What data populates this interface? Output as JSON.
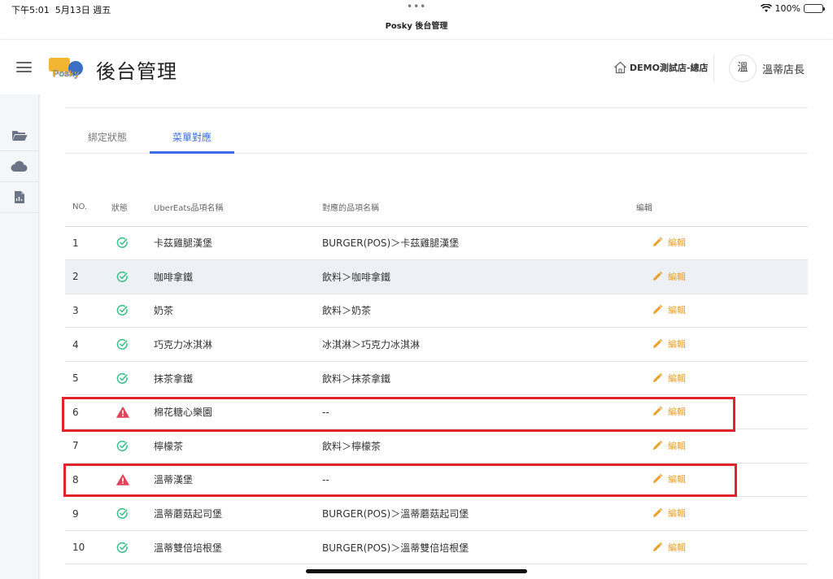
{
  "statusbar": {
    "time": "下午5:01",
    "date": "5月13日 週五",
    "dots": "•••",
    "battery": "100%"
  },
  "app_title": "Posky 後台管理",
  "header": {
    "logo_text": "Posky",
    "title": "後台管理",
    "store": "DEMO測試店-總店",
    "avatar": "溫",
    "user": "溫蒂店長"
  },
  "sidebar": {
    "items": [
      "folder-icon",
      "cloud-icon",
      "document-icon"
    ]
  },
  "tabs": [
    {
      "label": "綁定狀態",
      "active": false
    },
    {
      "label": "菜單對應",
      "active": true
    }
  ],
  "table": {
    "headers": {
      "no": "NO.",
      "status": "狀態",
      "ubereats": "UberEats品項名稱",
      "mapped": "對應的品項名稱",
      "edit": "編輯"
    },
    "rows": [
      {
        "no": "1",
        "status": "ok",
        "ubereats": "卡茲雞腿漢堡",
        "mapped": "BURGER(POS)＞卡茲雞腿漢堡",
        "edit": "編輯"
      },
      {
        "no": "2",
        "status": "ok",
        "ubereats": "咖啡拿鐵",
        "mapped": "飲料＞咖啡拿鐵",
        "edit": "編輯"
      },
      {
        "no": "3",
        "status": "ok",
        "ubereats": "奶茶",
        "mapped": "飲料＞奶茶",
        "edit": "編輯"
      },
      {
        "no": "4",
        "status": "ok",
        "ubereats": "巧克力冰淇淋",
        "mapped": "冰淇淋＞巧克力冰淇淋",
        "edit": "編輯"
      },
      {
        "no": "5",
        "status": "ok",
        "ubereats": "抹茶拿鐵",
        "mapped": "飲料＞抹茶拿鐵",
        "edit": "編輯"
      },
      {
        "no": "6",
        "status": "warning",
        "ubereats": "棉花糖心樂園",
        "mapped": "--",
        "edit": "編輯"
      },
      {
        "no": "7",
        "status": "ok",
        "ubereats": "檸檬茶",
        "mapped": "飲料＞檸檬茶",
        "edit": "編輯"
      },
      {
        "no": "8",
        "status": "warning",
        "ubereats": "溫蒂漢堡",
        "mapped": "--",
        "edit": "編輯"
      },
      {
        "no": "9",
        "status": "ok",
        "ubereats": "溫蒂蘑菇起司堡",
        "mapped": "BURGER(POS)＞溫蒂蘑菇起司堡",
        "edit": "編輯"
      },
      {
        "no": "10",
        "status": "ok",
        "ubereats": "溫蒂雙倍培根堡",
        "mapped": "BURGER(POS)＞溫蒂雙倍培根堡",
        "edit": "編輯"
      }
    ]
  },
  "colors": {
    "accent": "#3a6ee8",
    "ok": "#3cc08a",
    "warning": "#e0445c",
    "edit": "#e8a12f",
    "highlight_box": "#e0242e"
  }
}
